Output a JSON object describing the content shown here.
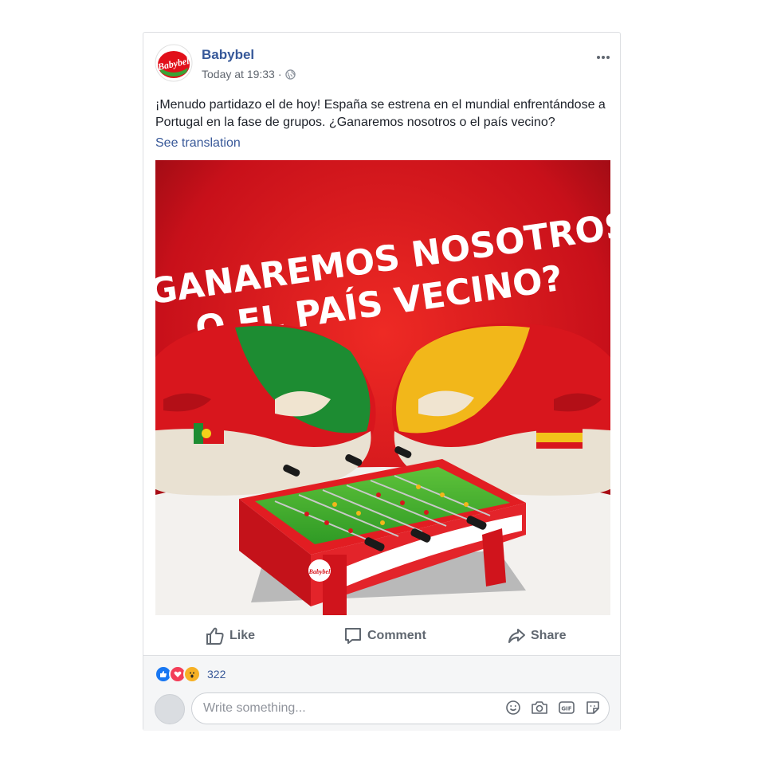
{
  "post": {
    "page_name": "Babybel",
    "timestamp": "Today at 19:33",
    "separator": "·",
    "audience_icon": "globe-icon",
    "logo_text": "Babybel",
    "text": "¡Menudo partidazo el de hoy! España se estrena en el mundial enfrentándose a Portugal en la fase de grupos. ¿Ganaremos nosotros o el país vecino?",
    "see_translation": "See translation",
    "more_icon": "ellipsis-icon",
    "image": {
      "headline_line1": "¿GANAREMOS NOSOTROS",
      "headline_line2": "O EL PAÍS VECINO?",
      "table_logo_text": "Babybel",
      "colors": {
        "background": "#d9141b",
        "portugal_green": "#1d8c32",
        "spain_yellow": "#f2b71a"
      }
    }
  },
  "actions": {
    "like": "Like",
    "comment": "Comment",
    "share": "Share"
  },
  "reactions": {
    "types": [
      "like",
      "love",
      "wow"
    ],
    "count": "322",
    "colors": {
      "like": "#1877f2",
      "love": "#f33e58",
      "wow": "#f7b125"
    }
  },
  "comment_box": {
    "placeholder": "Write something...",
    "icons": [
      "emoji-icon",
      "camera-icon",
      "gif-icon",
      "sticker-icon"
    ]
  }
}
